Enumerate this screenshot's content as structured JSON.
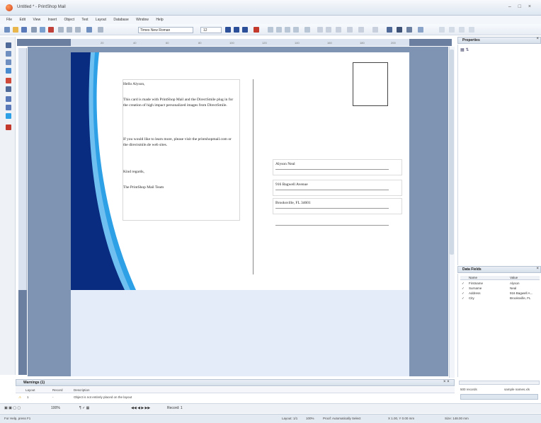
{
  "window": {
    "title": "Untitled * - PrintShop Mail",
    "controls": "– □ ×"
  },
  "menu": [
    "File",
    "Edit",
    "View",
    "Insert",
    "Object",
    "Text",
    "Layout",
    "Database",
    "Window",
    "Help"
  ],
  "toolbar": {
    "font": "Times New Roman",
    "size": "12"
  },
  "ruler": [
    "20",
    "40",
    "60",
    "80",
    "100",
    "120",
    "140",
    "160",
    "180",
    "200"
  ],
  "card": {
    "message": [
      "Hello Alyson,",
      "This card is made with PrintShop Mail and the DirectSmile plug in for the creation of high impact personalized images from DirectSmile.",
      "If you would like to learn more, please visit the printshopmail.com or the directsmile.de web sites.",
      "Kind regards,",
      "The PrintShop Mail Team"
    ],
    "address": [
      "Alyson Neal",
      "916 Bagwell Avenue",
      "Brooksville, FL 34601"
    ]
  },
  "properties": {
    "title": "Properties",
    "close": "×"
  },
  "data_fields": {
    "title": "Data Fields",
    "close": "×",
    "columns": [
      "Name",
      "Value"
    ],
    "rows": [
      {
        "name": "Firstname",
        "value": "Alyson"
      },
      {
        "name": "Surname",
        "value": "Neal"
      },
      {
        "name": "Address",
        "value": "916 Bagwell A..."
      },
      {
        "name": "City",
        "value": "Brooksville, FL"
      }
    ],
    "record_count": "500 records",
    "sample": "sample names.xls"
  },
  "warnings": {
    "title": "Warnings (1)",
    "close": "× ×",
    "columns": [
      "Layout",
      "Record",
      "Description"
    ],
    "row": {
      "layout": "1",
      "record": "-",
      "description": "Object is not entirely placed on the layout"
    }
  },
  "nav": {
    "zoom": "100%",
    "record": "Record: 1"
  },
  "status": {
    "left": "For Help, press F1",
    "layout": "Layout: 1/1",
    "zoom": "100%",
    "proof": "Proof: Automatically Select",
    "coords": "X 1.00, Y 0.00 mm",
    "size": "Size: 148.00 mm"
  },
  "colors": {
    "panel_blue": "#7f93b3",
    "card_navy": "#0a2c80",
    "card_cyan": "#2da0e6",
    "card_pale": "#e3ecf8"
  }
}
